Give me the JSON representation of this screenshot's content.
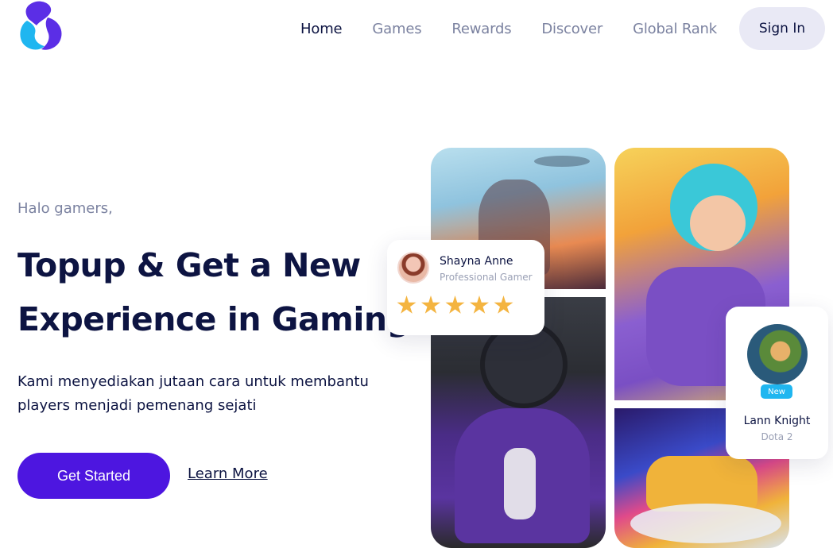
{
  "nav": {
    "logo_icon": "s-logo-icon",
    "items": [
      {
        "label": "Home",
        "active": true
      },
      {
        "label": "Games",
        "active": false
      },
      {
        "label": "Rewards",
        "active": false
      },
      {
        "label": "Discover",
        "active": false
      },
      {
        "label": "Global Rank",
        "active": false
      }
    ],
    "signin_label": "Sign In"
  },
  "hero": {
    "greeting": "Halo gamers,",
    "headline_part1": "Topup & Get a",
    "headline_highlight1": "New",
    "headline_highlight2": "Experience",
    "headline_part2": "in Gaming",
    "description": "Kami menyediakan jutaan cara untuk membantu players menjadi pemenang sejati",
    "cta_primary": "Get Started",
    "cta_secondary": "Learn More"
  },
  "review_card": {
    "name": "Shayna Anne",
    "role": "Professional Gamer",
    "rating": 5
  },
  "player_card": {
    "badge": "New",
    "name": "Lann Knight",
    "game": "Dota 2"
  },
  "colors": {
    "primary": "#4d16e0",
    "accent": "#1fb6f0",
    "text_dark": "#0d1442",
    "text_muted": "#7b82a0",
    "star": "#f4b440"
  }
}
